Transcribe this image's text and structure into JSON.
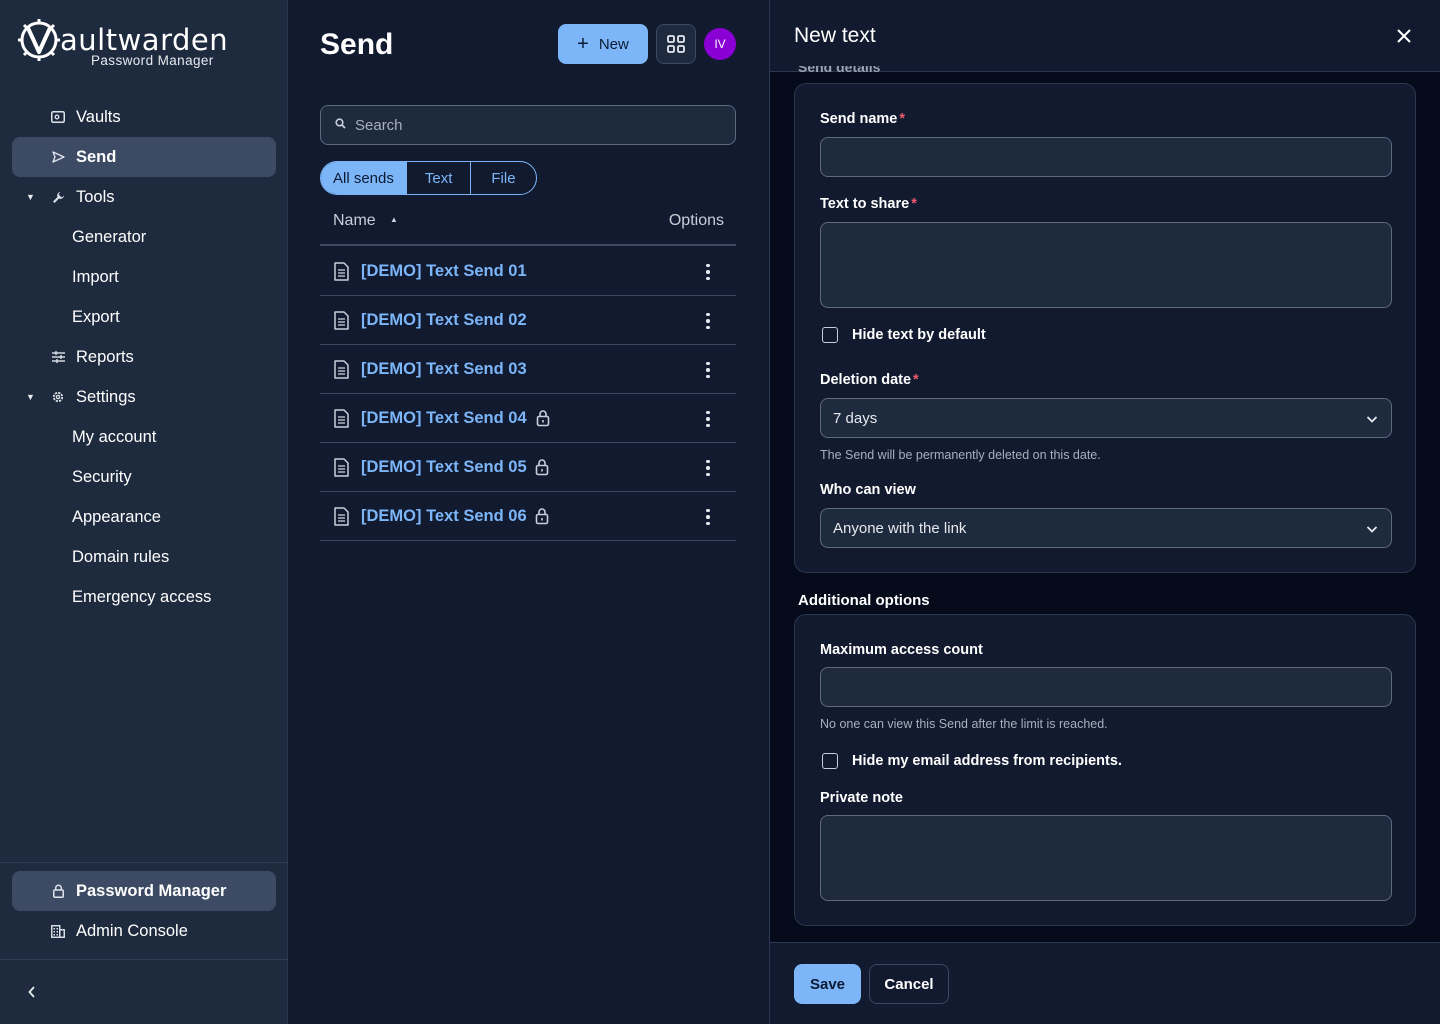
{
  "brand": {
    "word": "aultwarden",
    "subtitle": "Password Manager"
  },
  "sidebar": {
    "items": [
      {
        "label": "Vaults",
        "icon": "vault-icon"
      },
      {
        "label": "Send",
        "icon": "send-icon",
        "active": true
      },
      {
        "label": "Tools",
        "icon": "wrench-icon",
        "expanded": true
      },
      {
        "label": "Generator"
      },
      {
        "label": "Import"
      },
      {
        "label": "Export"
      },
      {
        "label": "Reports",
        "icon": "sliders-icon"
      },
      {
        "label": "Settings",
        "icon": "gear-icon",
        "expanded": true
      },
      {
        "label": "My account"
      },
      {
        "label": "Security"
      },
      {
        "label": "Appearance"
      },
      {
        "label": "Domain rules"
      },
      {
        "label": "Emergency access"
      }
    ],
    "products": [
      {
        "label": "Password Manager",
        "icon": "lock-icon",
        "active": true
      },
      {
        "label": "Admin Console",
        "icon": "building-icon"
      }
    ]
  },
  "main": {
    "title": "Send",
    "new_label": "New",
    "avatar_initials": "IV",
    "search_placeholder": "Search",
    "filters": [
      "All sends",
      "Text",
      "File"
    ],
    "columns": {
      "name": "Name",
      "options": "Options"
    },
    "rows": [
      {
        "name": "[DEMO] Text Send 01",
        "locked": false
      },
      {
        "name": "[DEMO] Text Send 02",
        "locked": false
      },
      {
        "name": "[DEMO] Text Send 03",
        "locked": false
      },
      {
        "name": "[DEMO] Text Send 04",
        "locked": true
      },
      {
        "name": "[DEMO] Text Send 05",
        "locked": true
      },
      {
        "name": "[DEMO] Text Send 06",
        "locked": true
      }
    ]
  },
  "drawer": {
    "title": "New text",
    "details_section": "Send details",
    "send_name_label": "Send name",
    "text_label": "Text to share",
    "hide_text_label": "Hide text by default",
    "deletion_label": "Deletion date",
    "deletion_value": "7 days",
    "deletion_hint": "The Send will be permanently deleted on this date.",
    "who_label": "Who can view",
    "who_value": "Anyone with the link",
    "additional_section": "Additional options",
    "max_access_label": "Maximum access count",
    "max_access_hint": "No one can view this Send after the limit is reached.",
    "hide_email_label": "Hide my email address from recipients.",
    "private_note_label": "Private note",
    "save_label": "Save",
    "cancel_label": "Cancel"
  },
  "colors": {
    "accent": "#7cb6f9",
    "sidebar_bg": "#1e2a3d",
    "main_bg": "#111a2e",
    "drawer_bg": "#050b1b",
    "required": "#ef5a6f",
    "avatar": "#8a00d4"
  }
}
